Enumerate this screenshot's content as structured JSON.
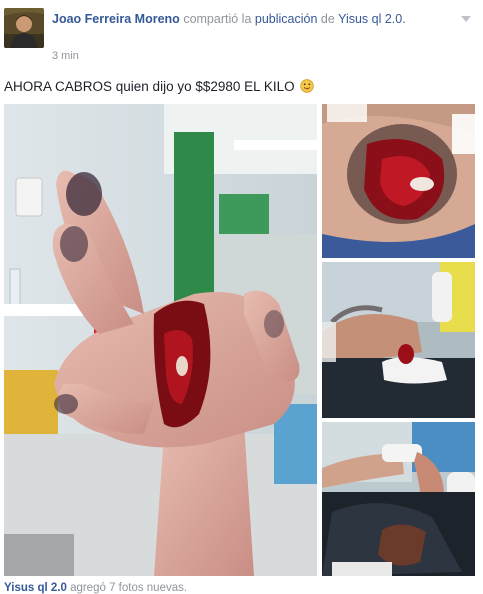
{
  "post": {
    "author": "Joao Ferreira Moreno",
    "action": "compartió la",
    "object_link": "publicación",
    "preposition": "de",
    "page_name": "Yisus ql 2.0.",
    "time": "3 min",
    "text": "AHORA CABROS quien dijo yo $$2980 EL KILO"
  },
  "icons": {
    "menu": "chevron-down-icon",
    "emoji": "tongue-face-emoji"
  },
  "footer": {
    "page_name": "Yisus ql 2.0",
    "action": "agregó 7 fotos nuevas."
  },
  "colors": {
    "link": "#365899",
    "muted": "#90949c",
    "text": "#1d2129"
  }
}
